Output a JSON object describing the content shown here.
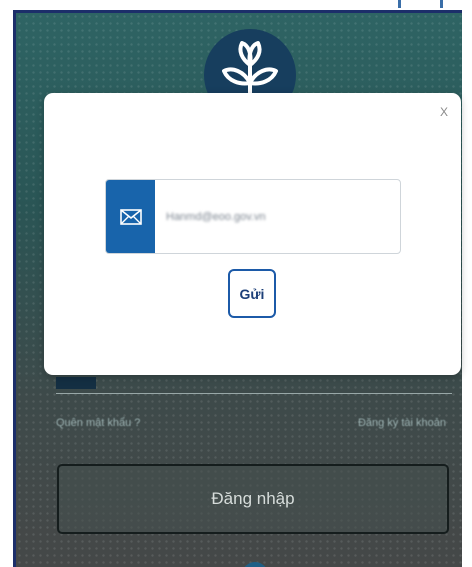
{
  "login": {
    "forgot_password": "Quên mật khẩu ?",
    "register": "Đăng ký tài khoản",
    "login_button": "Đăng nhập"
  },
  "modal": {
    "close_label": "X",
    "email_value": "Hanmd@eoo.gov.vn",
    "send_label": "Gửi"
  },
  "icons": {
    "logo": "leaf-emblem-icon",
    "email": "envelope-icon"
  },
  "colors": {
    "accent": "#1864ab",
    "send_border": "#1c5aa8"
  }
}
